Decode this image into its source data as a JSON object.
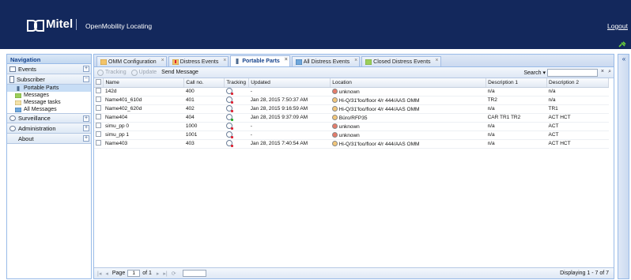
{
  "header": {
    "brand": "Mitel",
    "app_name": "OpenMobility Locating",
    "logout": "Logout"
  },
  "nav": {
    "title": "Navigation",
    "sections": [
      {
        "label": "Events",
        "toggle": "+"
      },
      {
        "label": "Subscriber",
        "toggle": "−",
        "items": [
          "Portable Parts",
          "Messages",
          "Message tasks",
          "All Messages"
        ]
      },
      {
        "label": "Surveillance",
        "toggle": "+"
      },
      {
        "label": "Administration",
        "toggle": "+"
      },
      {
        "label": "About",
        "toggle": "+"
      }
    ]
  },
  "tabs": [
    {
      "label": "OMM Configuration",
      "close": "×"
    },
    {
      "label": "Distress Events",
      "close": "×"
    },
    {
      "label": "Portable Parts",
      "close": "×"
    },
    {
      "label": "All Distress Events",
      "close": "×"
    },
    {
      "label": "Closed Distress Events",
      "close": "×"
    }
  ],
  "toolbar": {
    "tracking": "Tracking",
    "update": "Update",
    "send_message": "Send Message",
    "search_label": "Search ▾",
    "clear": "×",
    "go": "⌕"
  },
  "grid": {
    "columns": [
      "Name",
      "Call no.",
      "Tracking",
      "Updated",
      "Location",
      "Description 1",
      "Description 2"
    ],
    "rows": [
      {
        "name": "142d",
        "call": "400",
        "tracking": "off",
        "updated": "-",
        "location": "unknown",
        "loc_state": "red",
        "d1": "n/a",
        "d2": "n/a"
      },
      {
        "name": "Name401_610d",
        "call": "401",
        "tracking": "off",
        "updated": "Jan 28, 2015 7:50:37 AM",
        "location": "Hi-Q/31'foo/floor 4/r 444/AAS OMM",
        "loc_state": "ok",
        "d1": "TR2",
        "d2": "n/a"
      },
      {
        "name": "Name402_620d",
        "call": "402",
        "tracking": "off",
        "updated": "Jan 28, 2015 9:16:59 AM",
        "location": "Hi-Q/31'foo/floor 4/r 444/AAS OMM",
        "loc_state": "ok",
        "d1": "n/a",
        "d2": "TR1"
      },
      {
        "name": "Name404",
        "call": "404",
        "tracking": "on",
        "updated": "Jan 28, 2015 9:37:09 AM",
        "location": "Büro/RFP35",
        "loc_state": "ok",
        "d1": "CAR TR1 TR2",
        "d2": "ACT HCT"
      },
      {
        "name": "simu_pp 0",
        "call": "1000",
        "tracking": "off",
        "updated": "-",
        "location": "unknown",
        "loc_state": "red",
        "d1": "n/a",
        "d2": "ACT"
      },
      {
        "name": "simu_pp 1",
        "call": "1001",
        "tracking": "off",
        "updated": "-",
        "location": "unknown",
        "loc_state": "red",
        "d1": "n/a",
        "d2": "ACT"
      },
      {
        "name": "Name403",
        "call": "403",
        "tracking": "off",
        "updated": "Jan 28, 2015 7:40:54 AM",
        "location": "Hi-Q/31'foo/floor 4/r 444/AAS OMM",
        "loc_state": "ok",
        "d1": "n/a",
        "d2": "ACT HCT"
      }
    ]
  },
  "pager": {
    "page_label": "Page",
    "page_value": "1",
    "of_label": "of 1",
    "first": "|◂",
    "prev": "◂",
    "next": "▸",
    "last": "▸|",
    "refresh": "⟳",
    "displaying": "Displaying 1 - 7 of 7"
  },
  "right_panel": {
    "collapse": "«"
  }
}
